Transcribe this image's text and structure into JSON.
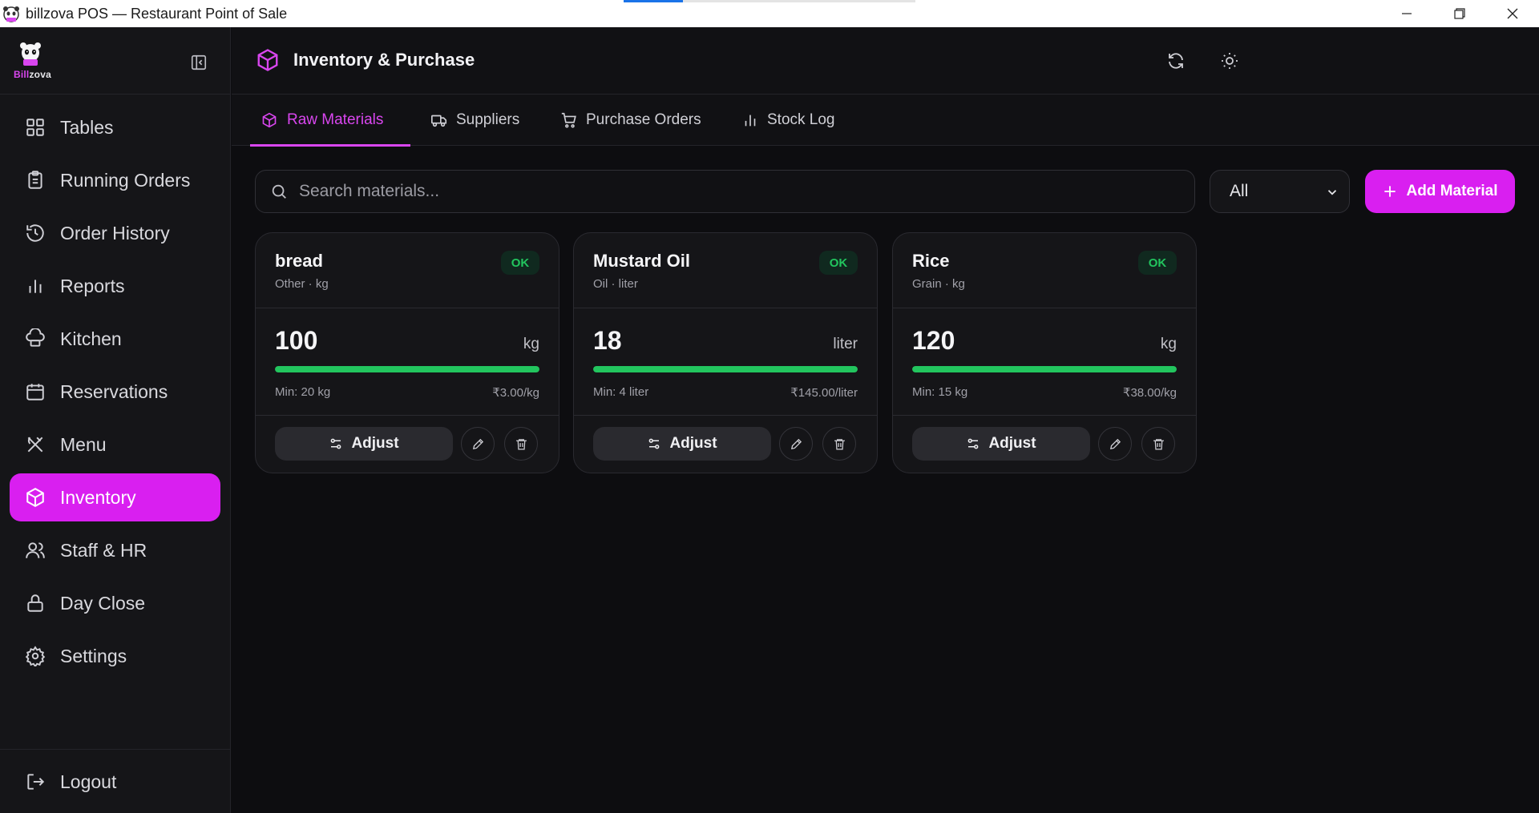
{
  "window": {
    "title": "billzova POS — Restaurant Point of Sale"
  },
  "logo": {
    "text_part1": "Bill",
    "text_part2": "zova"
  },
  "sidebar": {
    "items": [
      {
        "label": "Tables",
        "icon": "grid-icon"
      },
      {
        "label": "Running Orders",
        "icon": "clipboard-icon"
      },
      {
        "label": "Order History",
        "icon": "history-icon"
      },
      {
        "label": "Reports",
        "icon": "bar-chart-icon"
      },
      {
        "label": "Kitchen",
        "icon": "chef-hat-icon"
      },
      {
        "label": "Reservations",
        "icon": "calendar-icon"
      },
      {
        "label": "Menu",
        "icon": "utensils-icon"
      },
      {
        "label": "Inventory",
        "icon": "box-icon",
        "active": true
      },
      {
        "label": "Staff & HR",
        "icon": "users-icon"
      },
      {
        "label": "Day Close",
        "icon": "lock-icon"
      },
      {
        "label": "Settings",
        "icon": "gear-icon"
      }
    ],
    "logout_label": "Logout"
  },
  "header": {
    "title": "Inventory & Purchase"
  },
  "tabs": [
    {
      "label": "Raw Materials",
      "icon": "box-icon",
      "active": true
    },
    {
      "label": "Suppliers",
      "icon": "truck-icon"
    },
    {
      "label": "Purchase Orders",
      "icon": "cart-icon"
    },
    {
      "label": "Stock Log",
      "icon": "bar-chart-icon"
    }
  ],
  "toolbar": {
    "search_placeholder": "Search materials...",
    "filter_value": "All",
    "add_label": "Add Material"
  },
  "materials": [
    {
      "name": "bread",
      "category_unit": "Other · kg",
      "status": "OK",
      "quantity": "100",
      "unit": "kg",
      "stock_level": 1.0,
      "min": "Min: 20 kg",
      "price": "₹3.00/kg",
      "adjust_label": "Adjust"
    },
    {
      "name": "Mustard Oil",
      "category_unit": "Oil · liter",
      "status": "OK",
      "quantity": "18",
      "unit": "liter",
      "stock_level": 1.0,
      "min": "Min: 4 liter",
      "price": "₹145.00/liter",
      "adjust_label": "Adjust"
    },
    {
      "name": "Rice",
      "category_unit": "Grain · kg",
      "status": "OK",
      "quantity": "120",
      "unit": "kg",
      "stock_level": 1.0,
      "min": "Min: 15 kg",
      "price": "₹38.00/kg",
      "adjust_label": "Adjust"
    }
  ],
  "colors": {
    "accent": "#d91ff0",
    "ok": "#22c55e",
    "background": "#0d0d10"
  }
}
